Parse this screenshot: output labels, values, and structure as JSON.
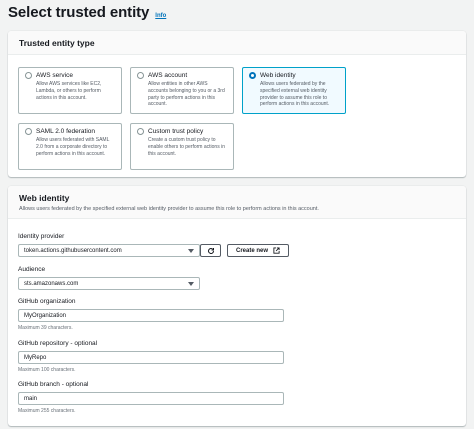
{
  "header": {
    "title": "Select trusted entity",
    "info_label": "Info"
  },
  "entity_type": {
    "title": "Trusted entity type",
    "options": [
      {
        "label": "AWS service",
        "description": "Allow AWS services like EC2, Lambda, or others to perform actions in this account.",
        "selected": false
      },
      {
        "label": "AWS account",
        "description": "Allow entities in other AWS accounts belonging to you or a 3rd party to perform actions in this account.",
        "selected": false
      },
      {
        "label": "Web identity",
        "description": "Allows users federated by the specified external web identity provider to assume this role to perform actions in this account.",
        "selected": true
      },
      {
        "label": "SAML 2.0 federation",
        "description": "Allow users federated with SAML 2.0 from a corporate directory to perform actions in this account.",
        "selected": false
      },
      {
        "label": "Custom trust policy",
        "description": "Create a custom trust policy to enable others to perform actions in this account.",
        "selected": false
      }
    ]
  },
  "web_identity": {
    "title": "Web identity",
    "description": "Allows users federated by the specified external web identity provider to assume this role to perform actions in this account.",
    "identity_provider": {
      "label": "Identity provider",
      "value": "token.actions.githubusercontent.com"
    },
    "refresh_icon": "refresh-icon",
    "create_new_label": "Create new",
    "audience": {
      "label": "Audience",
      "value": "sts.amazonaws.com"
    },
    "github_org": {
      "label": "GitHub organization",
      "value": "MyOrganization",
      "constraint": "Maximum 39 characters."
    },
    "github_repo": {
      "label": "GitHub repository - optional",
      "value": "MyRepo",
      "constraint": "Maximum 100 characters."
    },
    "github_branch": {
      "label": "GitHub branch - optional",
      "value": "main",
      "constraint": "Maximum 255 characters."
    }
  },
  "colors": {
    "accent": "#0073bb",
    "selected_border": "#00a1c9",
    "selected_bg": "#f1faff"
  }
}
